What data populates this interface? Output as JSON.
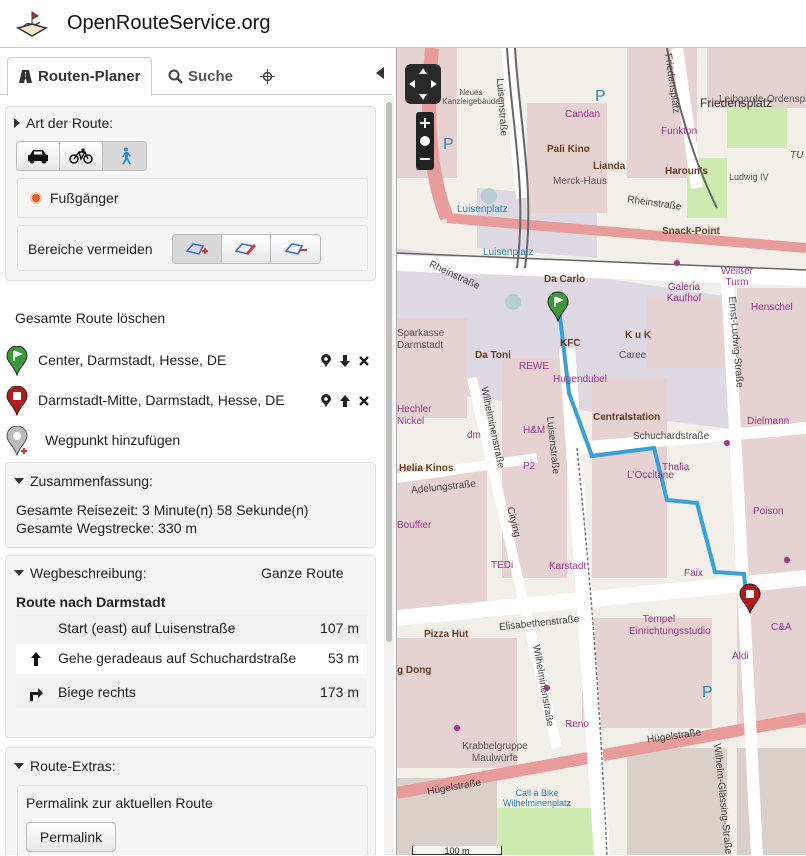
{
  "header": {
    "title": "OpenRouteService.org"
  },
  "tabs": {
    "route": "Routen-Planer",
    "search": "Suche"
  },
  "route_type": {
    "heading": "Art der Route:",
    "selected_mode": "Fußgänger",
    "avoid_label": "Bereiche vermeiden"
  },
  "route": {
    "clear_label": "Gesamte Route löschen",
    "start": "Center, Darmstadt, Hesse, DE",
    "end": "Darmstadt-Mitte, Darmstadt, Hesse, DE",
    "add_waypoint": "Wegpunkt hinzufügen"
  },
  "summary": {
    "heading": "Zusammenfassung:",
    "time": "Gesamte Reisezeit: 3 Minute(n) 58 Sekunde(n)",
    "distance": "Gesamte Wegstrecke: 330 m"
  },
  "directions": {
    "heading": "Wegbeschreibung:",
    "whole_route": "Ganze Route",
    "title": "Route nach Darmstadt",
    "steps": [
      {
        "text": "Start (east) auf Luisenstraße",
        "dist": "107 m"
      },
      {
        "text": "Gehe geradeaus auf Schuchardstraße",
        "dist": "53 m"
      },
      {
        "text": "Biege rechts",
        "dist": "173 m"
      }
    ]
  },
  "extras": {
    "heading": "Route-Extras:",
    "permalink_title": "Permalink zur aktuellen Route",
    "permalink_button": "Permalink"
  },
  "map": {
    "labels": {
      "luisenstrasse": "Luisenstraße",
      "friedensplatz": "Friedensplatz",
      "leibgarde": "Leibgarde-Ordensplatz",
      "neues_kanzlei": "Neues Kanzleigebäude",
      "candan": "Candan",
      "funkton": "Funkton",
      "pali": "Pali Kino",
      "lianda": "Lianda",
      "harouns": "Haroun's",
      "merck": "Merck-Haus",
      "ludwig": "Ludwig IV",
      "tu": "TU",
      "luisenplatz": "Luisenplatz",
      "rheinstrasse": "Rheinstraße",
      "snack": "Snack-Point",
      "dacarlo": "Da Carlo",
      "galeria": "Galeria Kaufhof",
      "weisser": "Weißer Turm",
      "henschel": "Henschel",
      "sparkasse": "Sparkasse Darmstadt",
      "kfc": "KFC",
      "kuk": "K u K",
      "caree": "Caree",
      "datoni": "Da Toni",
      "rewe": "REWE",
      "hugendubel": "Hugendubel",
      "ernst": "Ernst-Ludwig-Straße",
      "hechler": "Hechler Nickel",
      "hm": "H&M",
      "centralstation": "Centralstation",
      "schuchard": "Schuchardstraße",
      "dielmann": "Dielmann",
      "dm": "dm",
      "wilhelminen": "Wilhelminenstraße",
      "helia": "Helia Kinos",
      "thalia": "Thalia",
      "loccitane": "L'Occitane",
      "adelung": "Adelungstraße",
      "city": "Citying",
      "p2": "P2",
      "poison": "Poison",
      "bouffier": "Bouffier",
      "tedi": "TEDi",
      "karstadt": "Karstadt",
      "faix": "Faix",
      "elisabeth": "Elisabethenstraße",
      "pizzahut": "Pizza Hut",
      "tempel": "Tempel Einrichtungsstudio",
      "ca": "C&A",
      "aldi": "Aldi",
      "dong": "g Dong",
      "reno": "Reno",
      "huegel": "Hügelstraße",
      "krabbel": "Krabbelgruppe Maulwürfe",
      "callbike": "Call a Bike Wilhelminenplatz",
      "wilhelmglaessing": "Wilhelm-Glässing-Straße",
      "p": "P",
      "scale": "100 m"
    }
  },
  "colors": {
    "route": "#3aa0d8",
    "start_pin": "#3a9a3a",
    "end_pin": "#b31b1b"
  }
}
